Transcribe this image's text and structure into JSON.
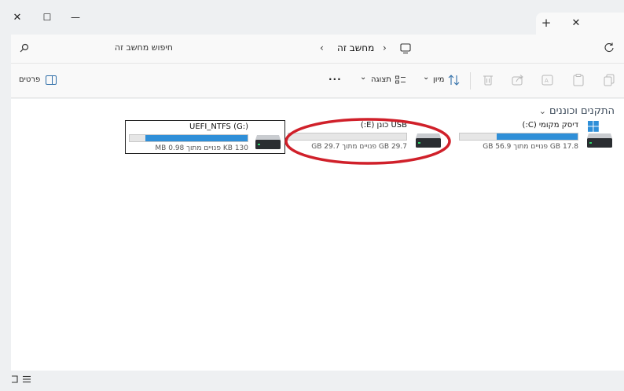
{
  "titlebar": {
    "close_glyph": "✕",
    "maximize_glyph": "☐",
    "minimize_glyph": "—",
    "tab_plus": "+",
    "tab_close": "✕"
  },
  "address": {
    "search_placeholder": "חיפוש מחשב זה",
    "crumb": "מחשב זה",
    "chevron": "›",
    "back_chevron": "‹"
  },
  "toolbar": {
    "details_label": "פרטים",
    "more_glyph": "···",
    "view_label": "תצוגה",
    "sort_label": "מיון",
    "dropdown_glyph": "⌄"
  },
  "section": {
    "title": "התקנים וכוננים",
    "chevron": "⌄"
  },
  "drives": [
    {
      "name": "דיסק מקומי (C:)",
      "space": "17.8 GB פנויים מתוך 56.9 GB",
      "used_fraction": 0.69,
      "windows_logo": true,
      "selected": false
    },
    {
      "name": "USB כונן (E:)",
      "space": "29.7 GB פנויים מתוך 29.7 GB",
      "used_fraction": 0.0,
      "windows_logo": false,
      "selected": false
    },
    {
      "name": "UEFI_NTFS (G:)",
      "space": "130 KB פנויים מתוך 0.98 MB",
      "used_fraction": 0.87,
      "windows_logo": false,
      "selected": true
    }
  ],
  "colors": {
    "accent": "#2f8fd8",
    "annotation": "#d0202a"
  }
}
